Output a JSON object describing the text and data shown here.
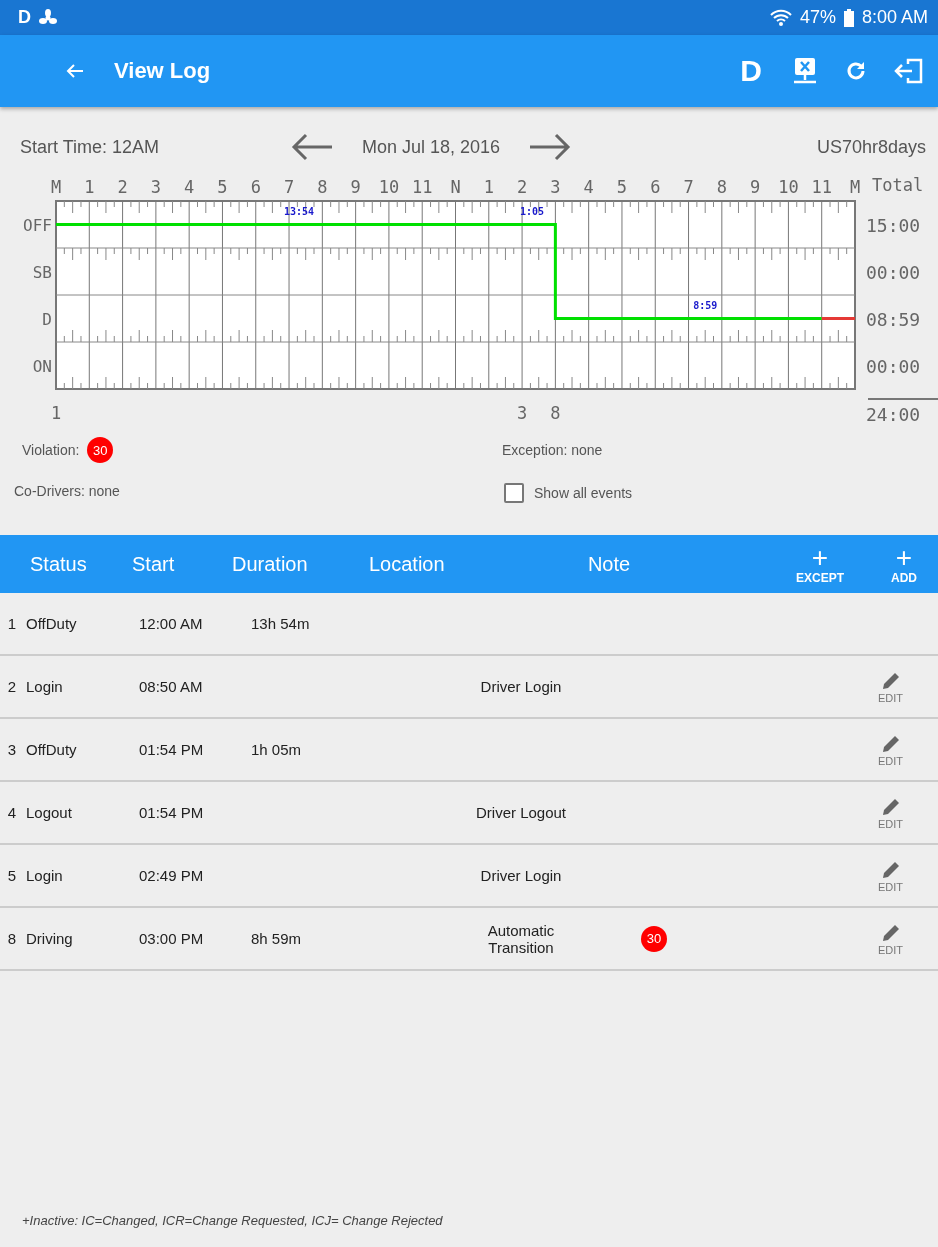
{
  "status_bar": {
    "left_text": "D",
    "battery": "47%",
    "time": "8:00 AM"
  },
  "app_bar": {
    "title": "View Log",
    "mode_letter": "D"
  },
  "date_bar": {
    "start_time": "Start Time: 12AM",
    "date": "Mon Jul 18, 2016",
    "ruleset": "US70hr8days"
  },
  "log_graph": {
    "total_header": "Total",
    "totals": [
      "15:00",
      "00:00",
      "08:59",
      "00:00"
    ],
    "grand_total": "24:00",
    "hour_labels": [
      "M",
      "1",
      "2",
      "3",
      "4",
      "5",
      "6",
      "7",
      "8",
      "9",
      "10",
      "11",
      "N",
      "1",
      "2",
      "3",
      "4",
      "5",
      "6",
      "7",
      "8",
      "9",
      "10",
      "11",
      "M"
    ],
    "status_rows": [
      "OFF",
      "SB",
      "D",
      "ON"
    ],
    "event_markers": [
      "1",
      "3",
      "8"
    ],
    "duration_labels": [
      "13:54",
      "1:05",
      "8:59"
    ]
  },
  "summary": {
    "violation_label": "Violation:",
    "violation_badge": "30",
    "exception": "Exception: none",
    "co_drivers": "Co-Drivers: none",
    "show_all_events": {
      "label": "Show all events",
      "checked": false
    }
  },
  "table": {
    "columns": [
      "Status",
      "Start",
      "Duration",
      "Location",
      "Note"
    ],
    "actions": [
      {
        "symbol": "+",
        "label": "EXCEPT"
      },
      {
        "symbol": "+",
        "label": "ADD"
      }
    ],
    "rows": [
      {
        "number": "1",
        "status": "OffDuty",
        "start": "12:00 AM",
        "duration": "13h 54m",
        "editable": false
      },
      {
        "number": "2",
        "status": "Login",
        "start": "08:50 AM",
        "note": "Driver Login",
        "editable": true,
        "edit_label": "EDIT"
      },
      {
        "number": "3",
        "status": "OffDuty",
        "start": "01:54 PM",
        "duration": "1h 05m",
        "editable": true,
        "edit_label": "EDIT"
      },
      {
        "number": "4",
        "status": "Logout",
        "start": "01:54 PM",
        "note": "Driver Logout",
        "editable": true,
        "edit_label": "EDIT"
      },
      {
        "number": "5",
        "status": "Login",
        "start": "02:49 PM",
        "note": "Driver Login",
        "editable": true,
        "edit_label": "EDIT"
      },
      {
        "number": "8",
        "status": "Driving",
        "start": "03:00 PM",
        "duration": "8h 59m",
        "note": "Automatic Transition",
        "badge": "30",
        "editable": true,
        "edit_label": "EDIT"
      }
    ]
  },
  "footer_note": "+Inactive: IC=Changed, ICR=Change Requested, ICJ= Change Rejected"
}
